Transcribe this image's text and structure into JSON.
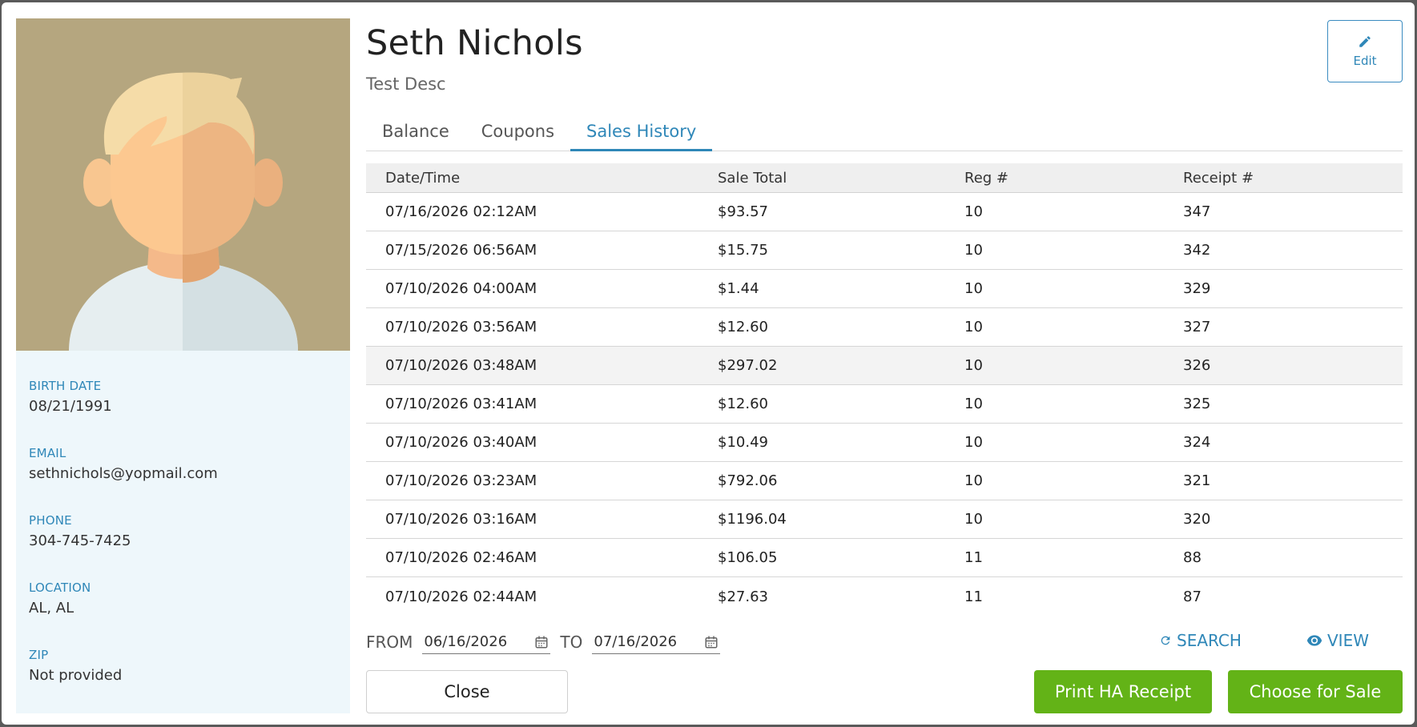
{
  "customer": {
    "name": "Seth Nichols",
    "description": "Test Desc"
  },
  "edit": {
    "label": "Edit",
    "icon": "pencil-icon"
  },
  "info": [
    {
      "label": "BIRTH DATE",
      "value": "08/21/1991"
    },
    {
      "label": "EMAIL",
      "value": "sethnichols@yopmail.com"
    },
    {
      "label": "PHONE",
      "value": "304-745-7425"
    },
    {
      "label": "LOCATION",
      "value": "AL, AL"
    },
    {
      "label": "ZIP",
      "value": "Not provided"
    }
  ],
  "tabs": [
    {
      "label": "Balance",
      "active": false
    },
    {
      "label": "Coupons",
      "active": false
    },
    {
      "label": "Sales History",
      "active": true
    }
  ],
  "table": {
    "headers": [
      "Date/Time",
      "Sale Total",
      "Reg #",
      "Receipt #"
    ],
    "rows": [
      [
        "07/16/2026 02:12AM",
        "$93.57",
        "10",
        "347"
      ],
      [
        "07/15/2026 06:56AM",
        "$15.75",
        "10",
        "342"
      ],
      [
        "07/10/2026 04:00AM",
        "$1.44",
        "10",
        "329"
      ],
      [
        "07/10/2026 03:56AM",
        "$12.60",
        "10",
        "327"
      ],
      [
        "07/10/2026 03:48AM",
        "$297.02",
        "10",
        "326"
      ],
      [
        "07/10/2026 03:41AM",
        "$12.60",
        "10",
        "325"
      ],
      [
        "07/10/2026 03:40AM",
        "$10.49",
        "10",
        "324"
      ],
      [
        "07/10/2026 03:23AM",
        "$792.06",
        "10",
        "321"
      ],
      [
        "07/10/2026 03:16AM",
        "$1196.04",
        "10",
        "320"
      ],
      [
        "07/10/2026 02:46AM",
        "$106.05",
        "11",
        "88"
      ],
      [
        "07/10/2026 02:44AM",
        "$27.63",
        "11",
        "87"
      ]
    ]
  },
  "filter": {
    "from_label": "FROM",
    "from_value": "06/16/2026",
    "to_label": "TO",
    "to_value": "07/16/2026",
    "search_label": "SEARCH",
    "view_label": "VIEW"
  },
  "footer": {
    "close_label": "Close",
    "print_label": "Print HA Receipt",
    "choose_label": "Choose for Sale"
  },
  "colors": {
    "accent": "#2f87b8",
    "green": "#63b317",
    "avatar_bg": "#b5a67f"
  }
}
